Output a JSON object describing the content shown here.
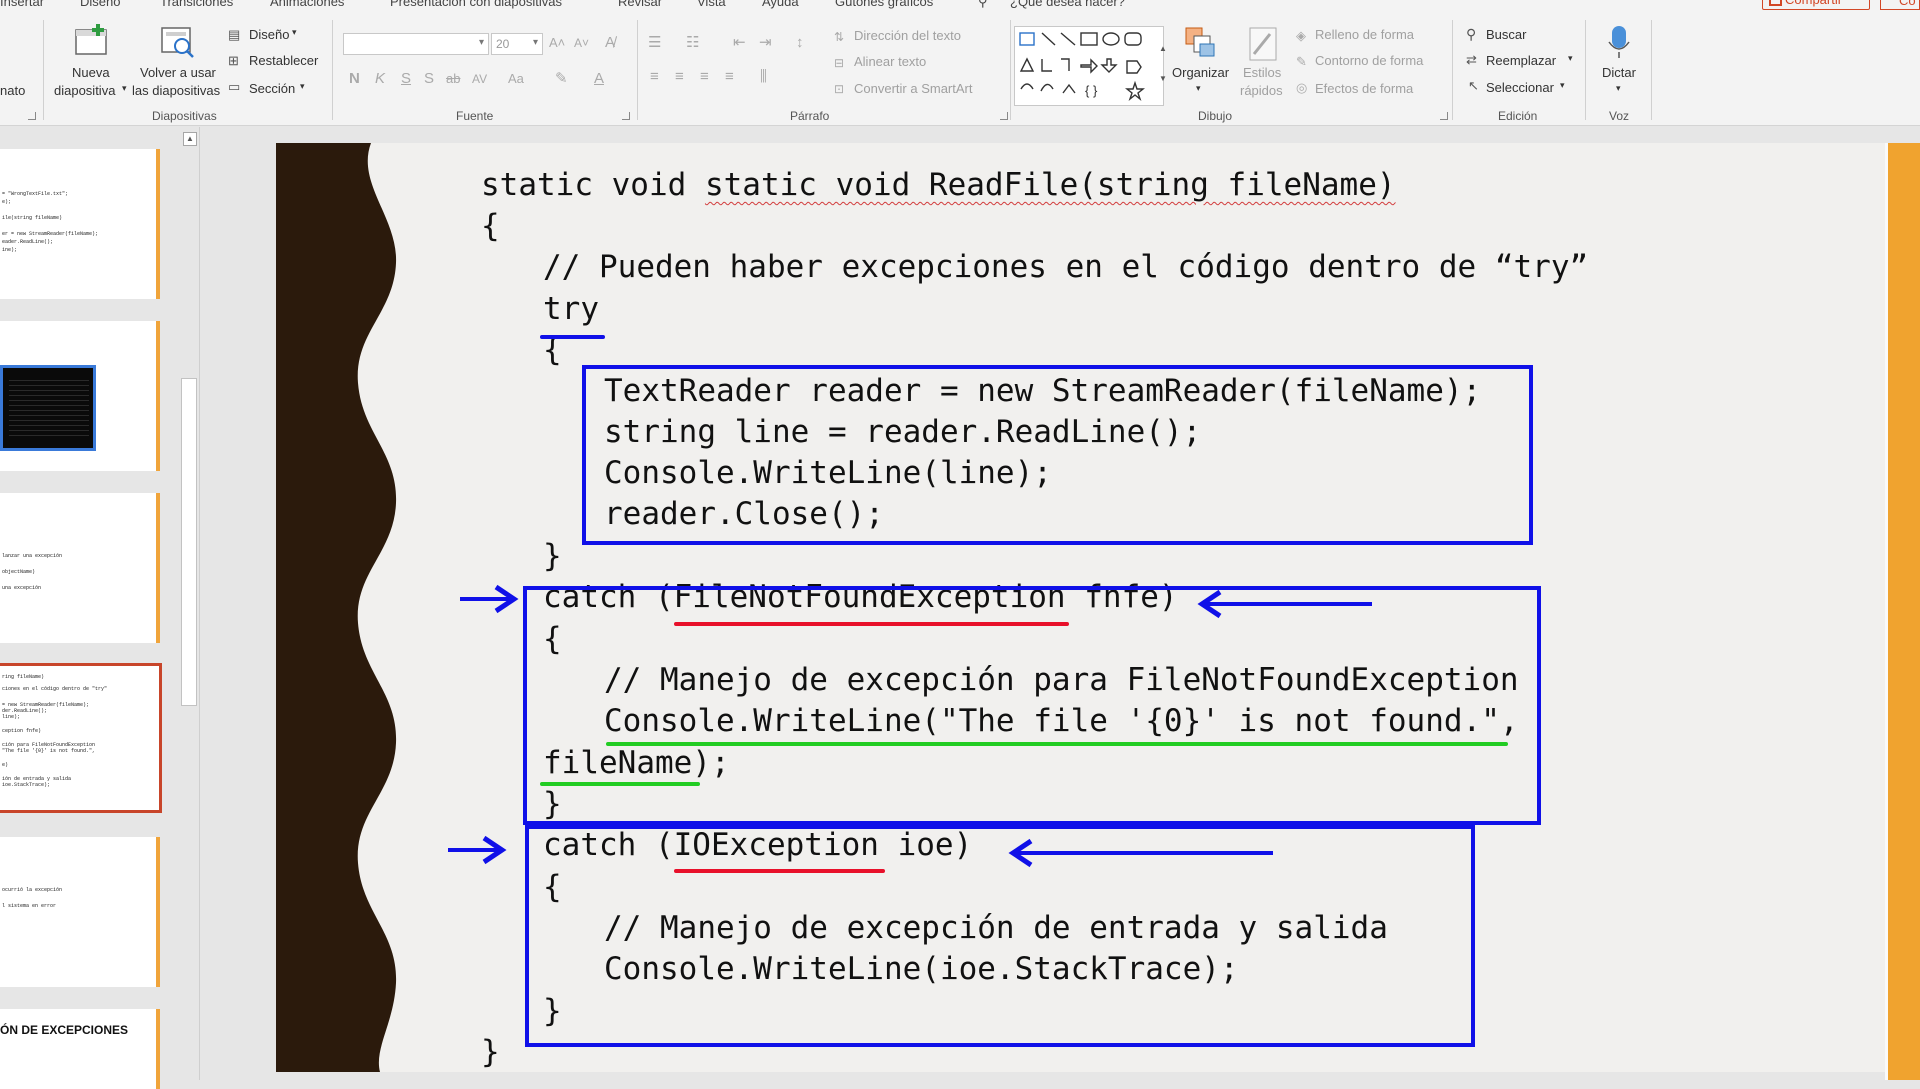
{
  "tabs": [
    "Insertar",
    "Diseño",
    "Transiciones",
    "Animaciones",
    "Presentación con diapositivas",
    "Revisar",
    "Vista",
    "Ayuda",
    "Gutones gráficos"
  ],
  "tell_me": "¿Qué desea hacer?",
  "share": "Compartir",
  "comments": "Co",
  "ribbon": {
    "formato_clip": "nato",
    "diapositivas": {
      "new_slide": [
        "Nueva",
        "diapositiva"
      ],
      "reuse": [
        "Volver a usar",
        "las diapositivas"
      ],
      "layout": "Diseño",
      "reset": "Restablecer",
      "section": "Sección",
      "label": "Diapositivas"
    },
    "fuente": {
      "font_name": "",
      "font_size": "20",
      "format_buttons": [
        "N",
        "K",
        "S",
        "S",
        "ab",
        "AV",
        "Aa"
      ],
      "label": "Fuente"
    },
    "parrafo": {
      "text_direction": "Dirección del texto",
      "align_text": "Alinear texto",
      "smartart": "Convertir a SmartArt",
      "label": "Párrafo"
    },
    "dibujo": {
      "arrange": "Organizar",
      "quick_styles": [
        "Estilos",
        "rápidos"
      ],
      "shape_fill": "Relleno de forma",
      "shape_outline": "Contorno de forma",
      "shape_effects": "Efectos de forma",
      "label": "Dibujo"
    },
    "edicion": {
      "find": "Buscar",
      "replace": "Reemplazar",
      "select": "Seleccionar",
      "label": "Edición"
    },
    "voz": {
      "dictate": "Dictar",
      "label": "Voz"
    }
  },
  "thumbnails": [
    {
      "lines": [
        "= \"WrongTextFile.txt\";",
        "e);",
        "",
        "ile(string fileName)",
        "",
        "er = new StreamReader(fileName);",
        "eader.ReadLine();",
        "ine);"
      ]
    },
    {
      "lines": []
    },
    {
      "lines": [
        "lanzar una excepción",
        "",
        "objectName)",
        "",
        "una excepción"
      ]
    },
    {
      "lines": [
        "ring fileName)",
        "",
        "ciones en el código dentro de \"try\"",
        "",
        "= new StreamReader(fileName);",
        "der.ReadLine();",
        "line);",
        "",
        "ception fnfe)",
        "",
        "ción para FileNotFoundException",
        "\"The file '{0}' is not found.\",",
        "",
        "e)",
        "",
        "ión de entrada y salida",
        "ioe.StackTrace);"
      ]
    },
    {
      "lines": [
        "",
        "",
        "ocurrió la excepción",
        "",
        "l sistema en error"
      ]
    },
    {
      "title": "ÓN DE EXCEPCIONES"
    }
  ],
  "slide": {
    "code": [
      "static void ReadFile(string fileName)",
      "{",
      "// Pueden haber excepciones en el código dentro de “try”",
      "try",
      "{",
      "TextReader reader = new StreamReader(fileName);",
      "string line = reader.ReadLine();",
      "Console.WriteLine(line);",
      "reader.Close();",
      "}",
      "catch (FileNotFoundException fnfe)",
      "{",
      "// Manejo de excepción para FileNotFoundException",
      "Console.WriteLine(\"The file '{0}' is not found.\",",
      "fileName);",
      "}",
      "catch (IOException ioe)",
      "{",
      "// Manejo de excepción de entrada y salida",
      "Console.WriteLine(ioe.StackTrace);",
      "}",
      "}"
    ]
  },
  "colors": {
    "annotation_blue": "#1010e8",
    "underline_red": "#e8102a",
    "underline_green": "#22cc22",
    "accent_orange": "#f0a32f",
    "wave_brown": "#2b1a0c"
  }
}
